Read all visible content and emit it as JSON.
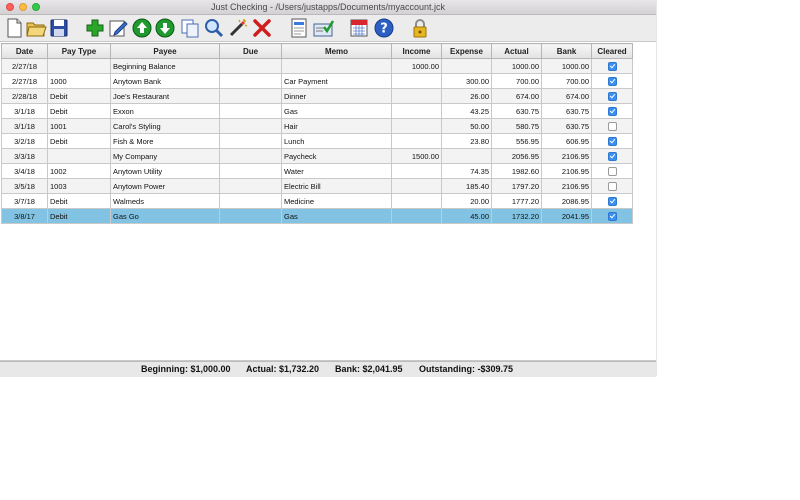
{
  "window": {
    "title": "Just Checking - /Users/justapps/Documents/myaccount.jck"
  },
  "toolbar": {
    "buttons": [
      {
        "name": "new-document"
      },
      {
        "name": "open-folder"
      },
      {
        "name": "save-disk"
      },
      {
        "name": "add-transaction"
      },
      {
        "name": "edit-transaction"
      },
      {
        "name": "move-up"
      },
      {
        "name": "move-down"
      },
      {
        "name": "copy"
      },
      {
        "name": "find"
      },
      {
        "name": "magic-wand"
      },
      {
        "name": "delete"
      },
      {
        "name": "report"
      },
      {
        "name": "reconcile"
      },
      {
        "name": "calendar"
      },
      {
        "name": "help"
      },
      {
        "name": "lock"
      }
    ]
  },
  "table": {
    "headers": [
      "Date",
      "Pay Type",
      "Payee",
      "Due",
      "Memo",
      "Income",
      "Expense",
      "Actual",
      "Bank",
      "Cleared"
    ],
    "rows": [
      {
        "date": "2/27/18",
        "paytype": "",
        "payee": "Beginning Balance",
        "due": "",
        "memo": "",
        "income": "1000.00",
        "expense": "",
        "actual": "1000.00",
        "bank": "1000.00",
        "cleared": true
      },
      {
        "date": "2/27/18",
        "paytype": "1000",
        "payee": "Anytown Bank",
        "due": "",
        "memo": "Car Payment",
        "income": "",
        "expense": "300.00",
        "actual": "700.00",
        "bank": "700.00",
        "cleared": true
      },
      {
        "date": "2/28/18",
        "paytype": "Debit",
        "payee": "Joe's Restaurant",
        "due": "",
        "memo": "Dinner",
        "income": "",
        "expense": "26.00",
        "actual": "674.00",
        "bank": "674.00",
        "cleared": true
      },
      {
        "date": "3/1/18",
        "paytype": "Debit",
        "payee": "Exxon",
        "due": "",
        "memo": "Gas",
        "income": "",
        "expense": "43.25",
        "actual": "630.75",
        "bank": "630.75",
        "cleared": true
      },
      {
        "date": "3/1/18",
        "paytype": "1001",
        "payee": "Carol's Styling",
        "due": "",
        "memo": "Hair",
        "income": "",
        "expense": "50.00",
        "actual": "580.75",
        "bank": "630.75",
        "cleared": false
      },
      {
        "date": "3/2/18",
        "paytype": "Debit",
        "payee": "Fish & More",
        "due": "",
        "memo": "Lunch",
        "income": "",
        "expense": "23.80",
        "actual": "556.95",
        "bank": "606.95",
        "cleared": true
      },
      {
        "date": "3/3/18",
        "paytype": "",
        "payee": "My Company",
        "due": "",
        "memo": "Paycheck",
        "income": "1500.00",
        "expense": "",
        "actual": "2056.95",
        "bank": "2106.95",
        "cleared": true
      },
      {
        "date": "3/4/18",
        "paytype": "1002",
        "payee": "Anytown Utility",
        "due": "",
        "memo": "Water",
        "income": "",
        "expense": "74.35",
        "actual": "1982.60",
        "bank": "2106.95",
        "cleared": false
      },
      {
        "date": "3/5/18",
        "paytype": "1003",
        "payee": "Anytown Power",
        "due": "",
        "memo": "Electric Bill",
        "income": "",
        "expense": "185.40",
        "actual": "1797.20",
        "bank": "2106.95",
        "cleared": false
      },
      {
        "date": "3/7/18",
        "paytype": "Debit",
        "payee": "Walmeds",
        "due": "",
        "memo": "Medicine",
        "income": "",
        "expense": "20.00",
        "actual": "1777.20",
        "bank": "2086.95",
        "cleared": true
      },
      {
        "date": "3/8/17",
        "paytype": "Debit",
        "payee": "Gas Go",
        "due": "",
        "memo": "Gas",
        "income": "",
        "expense": "45.00",
        "actual": "1732.20",
        "bank": "2041.95",
        "cleared": true,
        "selected": true
      }
    ]
  },
  "status": {
    "beginning": "Beginning: $1,000.00",
    "actual": "Actual: $1,732.20",
    "bank": "Bank: $2,041.95",
    "outstanding": "Outstanding: -$309.75"
  },
  "colors": {
    "selection": "#82c3e4",
    "checkbox": "#3b8ff1"
  }
}
